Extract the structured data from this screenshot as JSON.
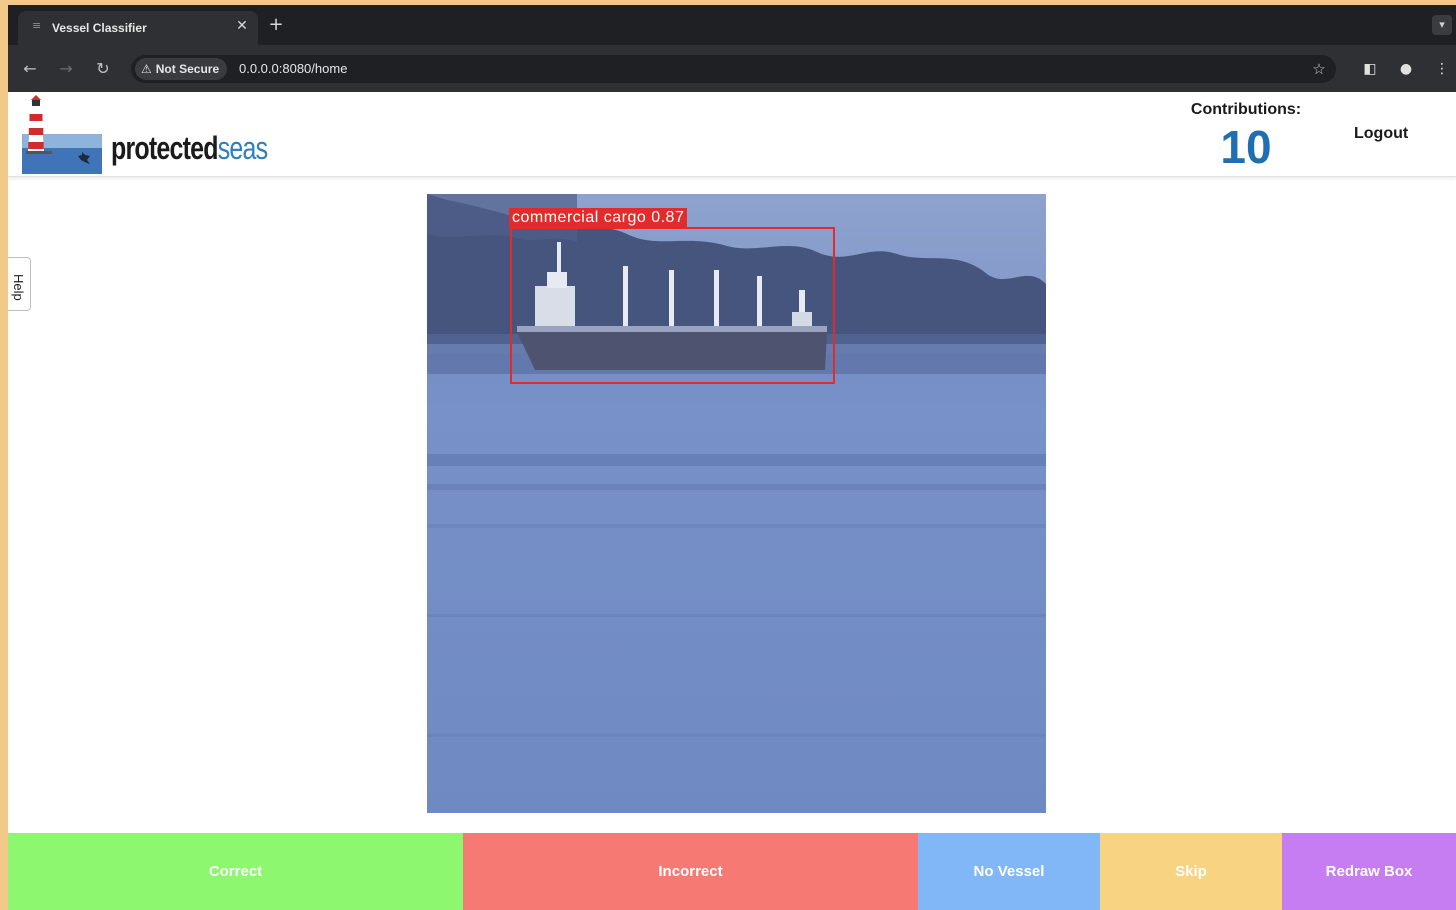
{
  "browser": {
    "tab_title": "Vessel Classifier",
    "security_label": "Not Secure",
    "url": "0.0.0.0:8080/home"
  },
  "header": {
    "logo_part1": "protected",
    "logo_part2": "seas",
    "contributions_label": "Contributions:",
    "contributions_count": "10",
    "logout_label": "Logout"
  },
  "help_label": "Help",
  "detection": {
    "label": "commercial cargo 0.87"
  },
  "actions": [
    {
      "label": "Correct",
      "color": "#8cf76f"
    },
    {
      "label": "Incorrect",
      "color": "#f67a73"
    },
    {
      "label": "No Vessel",
      "color": "#82b7f7"
    },
    {
      "label": "Skip",
      "color": "#f8d482"
    },
    {
      "label": "Redraw Box",
      "color": "#c57df1"
    }
  ],
  "colors": {
    "brand_blue": "#1f6fb2",
    "bbox_red": "#e32b2b"
  }
}
